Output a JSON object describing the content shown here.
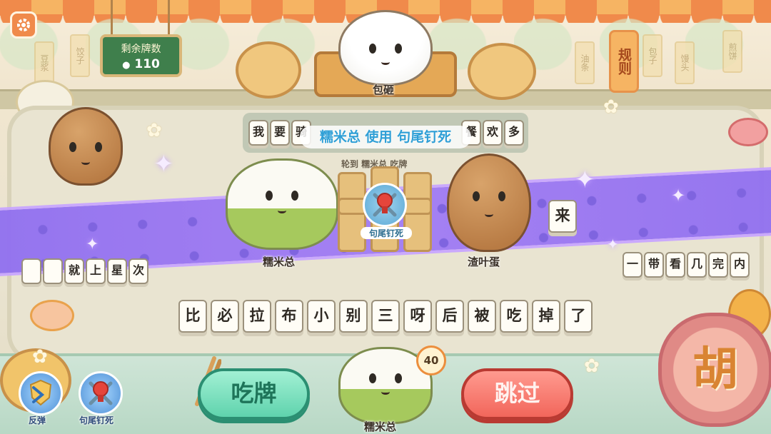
{
  "hud": {
    "remaining_title": "剩余牌数",
    "remaining_count": "110",
    "rules_label": "规则",
    "settings_icon": "gear-icon"
  },
  "background_tags": [
    "豆浆",
    "饺子",
    "油条",
    "包子",
    "馒头",
    "煎饼"
  ],
  "opponents": {
    "top": {
      "name": "包砸"
    },
    "left_hand_label": "",
    "center_left": {
      "name": "糯米总"
    },
    "center_right": {
      "name": "渣叶蛋"
    }
  },
  "action": {
    "banner": "糯米总 使用 句尾钉死",
    "played_label": "轮到 糯米总 吃牌",
    "card_label": "句尾钉死",
    "side_tile": "来"
  },
  "top_row_tiles": [
    "我",
    "要",
    "骑",
    "",
    "",
    "",
    "",
    "",
    "",
    "",
    "餐",
    "欢",
    "多"
  ],
  "left_row_tiles": [
    "",
    "",
    "就",
    "上",
    "星",
    "次"
  ],
  "right_row_tiles": [
    "一",
    "带",
    "看",
    "几",
    "完",
    "内"
  ],
  "hand_tiles": [
    "比",
    "必",
    "拉",
    "布",
    "小",
    "别",
    "三",
    "呀",
    "后",
    "被",
    "吃",
    "掉",
    "了"
  ],
  "player": {
    "name": "糯米总",
    "timer": "40"
  },
  "skills": [
    {
      "label": "反弹",
      "icon": "shield-reflect-icon"
    },
    {
      "label": "句尾钉死",
      "icon": "pin-icon"
    }
  ],
  "buttons": {
    "eat": "吃牌",
    "skip": "跳过",
    "hu": "胡"
  },
  "colors": {
    "eat_button": "#5fd3ad",
    "skip_button": "#f2665b",
    "hu_button": "#e08a86",
    "band": "#9a78f2",
    "banner_text": "#2f9fd6"
  }
}
